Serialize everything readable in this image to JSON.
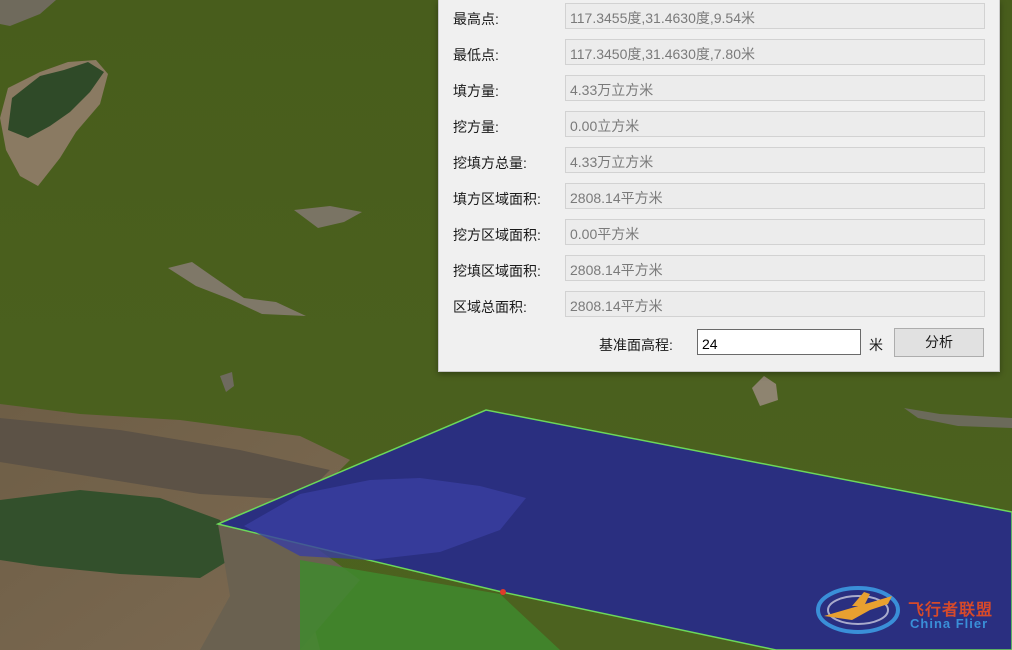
{
  "panel": {
    "rows": [
      {
        "label": "最高点:",
        "value": "117.3455度,31.4630度,9.54米"
      },
      {
        "label": "最低点:",
        "value": "117.3450度,31.4630度,7.80米"
      },
      {
        "label": "填方量:",
        "value": "4.33万立方米"
      },
      {
        "label": "挖方量:",
        "value": "0.00立方米"
      },
      {
        "label": "挖填方总量:",
        "value": "4.33万立方米"
      },
      {
        "label": "填方区域面积:",
        "value": "2808.14平方米"
      },
      {
        "label": "挖方区域面积:",
        "value": "0.00平方米"
      },
      {
        "label": "挖填区域面积:",
        "value": "2808.14平方米"
      },
      {
        "label": "区域总面积:",
        "value": "2808.14平方米"
      }
    ],
    "base_label": "基准面高程:",
    "base_value": "24",
    "unit": "米",
    "analyze_label": "分析"
  },
  "watermark": {
    "cn": "飞行者联盟",
    "en": "China Flier"
  },
  "colors": {
    "ground": "#4a5f1e",
    "fill_plane": "#2a2f80",
    "plane_edge": "#6cd85a",
    "panel_bg": "#f0f0f0"
  }
}
